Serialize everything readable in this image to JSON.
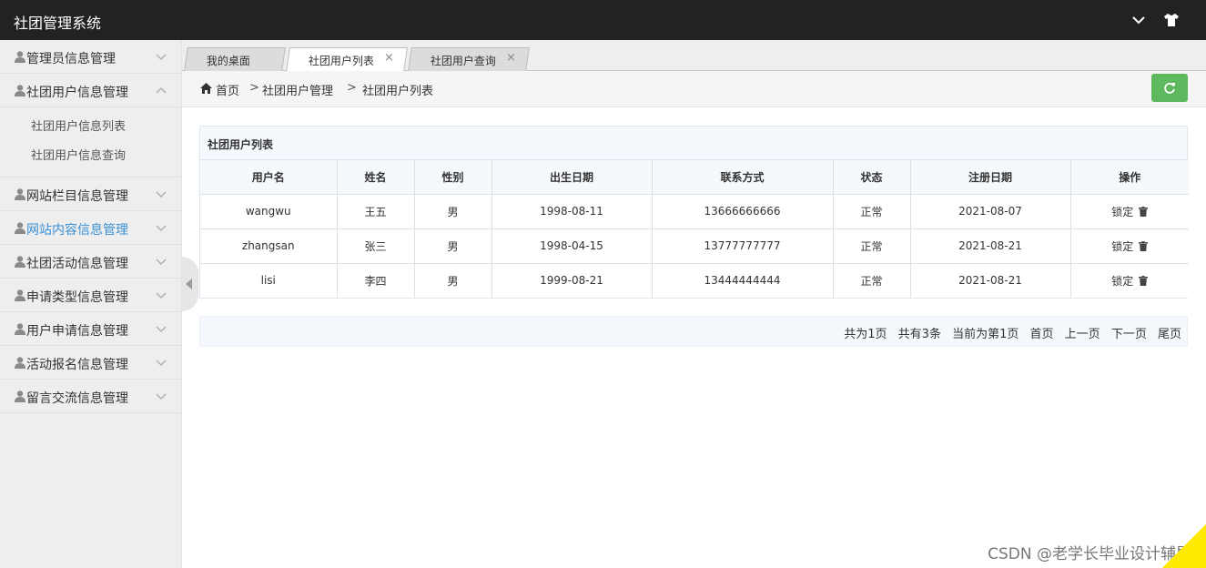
{
  "app": {
    "title": "社团管理系统"
  },
  "topbar": {
    "chevron_icon": "chevron-down-icon",
    "shirt_icon": "tshirt-icon"
  },
  "sidebar": {
    "items": [
      {
        "label": "管理员信息管理",
        "expanded": false,
        "active": false
      },
      {
        "label": "社团用户信息管理",
        "expanded": true,
        "active": false,
        "children": [
          {
            "label": "社团用户信息列表"
          },
          {
            "label": "社团用户信息查询"
          }
        ]
      },
      {
        "label": "网站栏目信息管理",
        "expanded": false,
        "active": false
      },
      {
        "label": "网站内容信息管理",
        "expanded": false,
        "active": true
      },
      {
        "label": "社团活动信息管理",
        "expanded": false,
        "active": false
      },
      {
        "label": "申请类型信息管理",
        "expanded": false,
        "active": false
      },
      {
        "label": "用户申请信息管理",
        "expanded": false,
        "active": false
      },
      {
        "label": "活动报名信息管理",
        "expanded": false,
        "active": false
      },
      {
        "label": "留言交流信息管理",
        "expanded": false,
        "active": false
      }
    ]
  },
  "tabs": [
    {
      "label": "我的桌面",
      "closable": false,
      "active": false
    },
    {
      "label": "社团用户列表",
      "closable": true,
      "active": true,
      "close": "×"
    },
    {
      "label": "社团用户查询",
      "closable": true,
      "active": false,
      "close": "×"
    }
  ],
  "breadcrumb": {
    "home": "首页",
    "sep": ">",
    "level1": "社团用户管理",
    "level2": "社团用户列表"
  },
  "colors": {
    "accent": "#3a8fd6",
    "refresh_button": "#5eb95e",
    "topbar": "#222222"
  },
  "table": {
    "title": "社团用户列表",
    "headers": [
      "用户名",
      "姓名",
      "性别",
      "出生日期",
      "联系方式",
      "状态",
      "注册日期",
      "操作"
    ],
    "rows": [
      {
        "username": "wangwu",
        "name": "王五",
        "gender": "男",
        "birth": "1998-08-11",
        "phone": "13666666666",
        "status": "正常",
        "reg_date": "2021-08-07",
        "action": "锁定"
      },
      {
        "username": "zhangsan",
        "name": "张三",
        "gender": "男",
        "birth": "1998-04-15",
        "phone": "13777777777",
        "status": "正常",
        "reg_date": "2021-08-21",
        "action": "锁定"
      },
      {
        "username": "lisi",
        "name": "李四",
        "gender": "男",
        "birth": "1999-08-21",
        "phone": "13444444444",
        "status": "正常",
        "reg_date": "2021-08-21",
        "action": "锁定"
      }
    ]
  },
  "pager": {
    "total_pages": "共为1页",
    "total_items": "共有3条",
    "current": "当前为第1页",
    "first": "首页",
    "prev": "上一页",
    "next": "下一页",
    "last": "尾页"
  },
  "watermark": "CSDN @老学长毕业设计辅导"
}
